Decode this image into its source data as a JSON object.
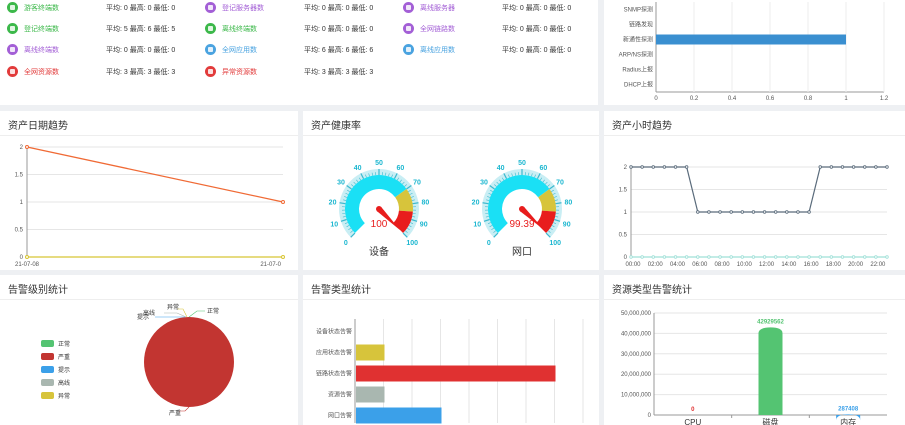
{
  "stats": [
    {
      "label": "游客终端数",
      "value": "平均: 0 最高: 0 最低: 0",
      "color": "#3cb84a"
    },
    {
      "label": "登记终端数",
      "value": "平均: 5 最高: 6 最低: 5",
      "color": "#3cb84a"
    },
    {
      "label": "离线终端数",
      "value": "平均: 0 最高: 0 最低: 0",
      "color": "#a35fd6"
    },
    {
      "label": "全网资源数",
      "value": "平均: 3 最高: 3 最低: 3",
      "color": "#e23b3b"
    },
    {
      "label": "登记服务器数",
      "value": "平均: 0 最高: 0 最低: 0",
      "color": "#a35fd6"
    },
    {
      "label": "离线终端数",
      "value": "平均: 0 最高: 0 最低: 0",
      "color": "#3cb84a"
    },
    {
      "label": "全网应用数",
      "value": "平均: 6 最高: 6 最低: 6",
      "color": "#4aa3e0"
    },
    {
      "label": "异常资源数",
      "value": "平均: 3 最高: 3 最低: 3",
      "color": "#e23b3b"
    },
    {
      "label": "离线服务器",
      "value": "平均: 0 最高: 0 最低: 0",
      "color": "#a35fd6"
    },
    {
      "label": "全网链路数",
      "value": "平均: 0 最高: 0 最低: 0",
      "color": "#a35fd6"
    },
    {
      "label": "离线应用数",
      "value": "平均: 0 最高: 0 最低: 0",
      "color": "#4aa3e0"
    }
  ],
  "probe_chart": {
    "chart_data": {
      "type": "bar",
      "orientation": "horizontal",
      "categories": [
        "SNMP探测",
        "链路发现",
        "新通性探测",
        "ARP/NS探测",
        "Radius上报",
        "DHCP上报"
      ],
      "values": [
        0,
        0,
        1,
        0,
        0,
        0
      ],
      "xlim": [
        0,
        1.2
      ],
      "xticks": [
        "0",
        "0.2",
        "0.4",
        "0.6",
        "0.8",
        "1",
        "1.2"
      ],
      "bar_color": "#3a8fd0"
    }
  },
  "panels": {
    "date_trend": "资产日期趋势",
    "health": "资产健康率",
    "hour_trend": "资产小时趋势",
    "alarm_level": "告警级别统计",
    "alarm_type": "告警类型统计",
    "resource_alarm": "资源类型告警统计"
  },
  "date_trend": {
    "chart_data": {
      "type": "line",
      "x": [
        "21-07-08",
        "21-07-0"
      ],
      "series": [
        {
          "values": [
            2,
            1
          ],
          "color": "#f06a35"
        },
        {
          "values": [
            0,
            0
          ],
          "color": "#d8c534"
        }
      ],
      "ylim": [
        0,
        2
      ],
      "yticks": [
        "0",
        "0.5",
        "1",
        "1.5",
        "2"
      ]
    }
  },
  "gauges": [
    {
      "label": "设备",
      "value": "100",
      "ticks": [
        "0",
        "10",
        "20",
        "30",
        "40",
        "50",
        "60",
        "70",
        "80",
        "90",
        "100"
      ]
    },
    {
      "label": "网口",
      "value": "99.39",
      "ticks": [
        "0",
        "10",
        "20",
        "30",
        "40",
        "50",
        "60",
        "70",
        "80",
        "90",
        "100"
      ]
    }
  ],
  "hour_trend": {
    "chart_data": {
      "type": "line",
      "xticks": [
        "00:00",
        "02:00",
        "04:00",
        "06:00",
        "08:00",
        "10:00",
        "12:00",
        "14:00",
        "16:00",
        "18:00",
        "20:00",
        "22:00"
      ],
      "series": [
        {
          "values": [
            2,
            2,
            2,
            2,
            2,
            2,
            1,
            1,
            1,
            1,
            1,
            1,
            1,
            1,
            1,
            1,
            1,
            2,
            2,
            2,
            2,
            2,
            2,
            2
          ],
          "color": "#5a6b7b"
        },
        {
          "values": [
            0,
            0,
            0,
            0,
            0,
            0,
            0,
            0,
            0,
            0,
            0,
            0,
            0,
            0,
            0,
            0,
            0,
            0,
            0,
            0,
            0,
            0,
            0,
            0
          ],
          "color": "#9fe0d8"
        }
      ],
      "ylim": [
        0,
        2
      ],
      "yticks": [
        "0",
        "0.5",
        "1",
        "1.5",
        "2"
      ]
    }
  },
  "alarm_level": {
    "legend": [
      {
        "label": "正常",
        "color": "#54c472"
      },
      {
        "label": "严重",
        "color": "#c23531"
      },
      {
        "label": "提示",
        "color": "#3ba0e9"
      },
      {
        "label": "高线",
        "color": "#a9b7b0"
      },
      {
        "label": "异常",
        "color": "#d7c43b"
      }
    ],
    "chart_data": {
      "type": "pie",
      "slices": [
        {
          "label": "严重",
          "value": 100,
          "color": "#c23531"
        },
        {
          "label": "正常",
          "value": 0,
          "color": "#54c472"
        },
        {
          "label": "提示",
          "value": 0,
          "color": "#3ba0e9"
        },
        {
          "label": "高线",
          "value": 0,
          "color": "#a9b7b0"
        },
        {
          "label": "异常",
          "value": 0,
          "color": "#d7c43b"
        }
      ]
    }
  },
  "alarm_type": {
    "chart_data": {
      "type": "bar",
      "orientation": "horizontal",
      "categories": [
        "设备状态告警",
        "应用状态告警",
        "链路状态告警",
        "资源告警",
        "网口告警"
      ],
      "values": [
        0,
        1,
        7,
        1,
        3
      ],
      "colors": [
        "#d7c43b",
        "#d7c43b",
        "#e03131",
        "#a9b7b0",
        "#3ba0e9"
      ],
      "xlim": [
        0,
        8
      ]
    }
  },
  "resource_alarm": {
    "chart_data": {
      "type": "bar",
      "categories": [
        "CPU",
        "磁盘",
        "内存"
      ],
      "values": [
        0,
        42929562,
        287408
      ],
      "labels": [
        "0",
        "42929562",
        "287408"
      ],
      "label_colors": [
        "#e03131",
        "#54c472",
        "#3ba0e9"
      ],
      "colors": [
        "#e03131",
        "#54c472",
        "#3ba0e9"
      ],
      "ylim": [
        0,
        50000000
      ],
      "yticks": [
        "0",
        "10,000,000",
        "20,000,000",
        "30,000,000",
        "40,000,000",
        "50,000,000"
      ]
    }
  }
}
